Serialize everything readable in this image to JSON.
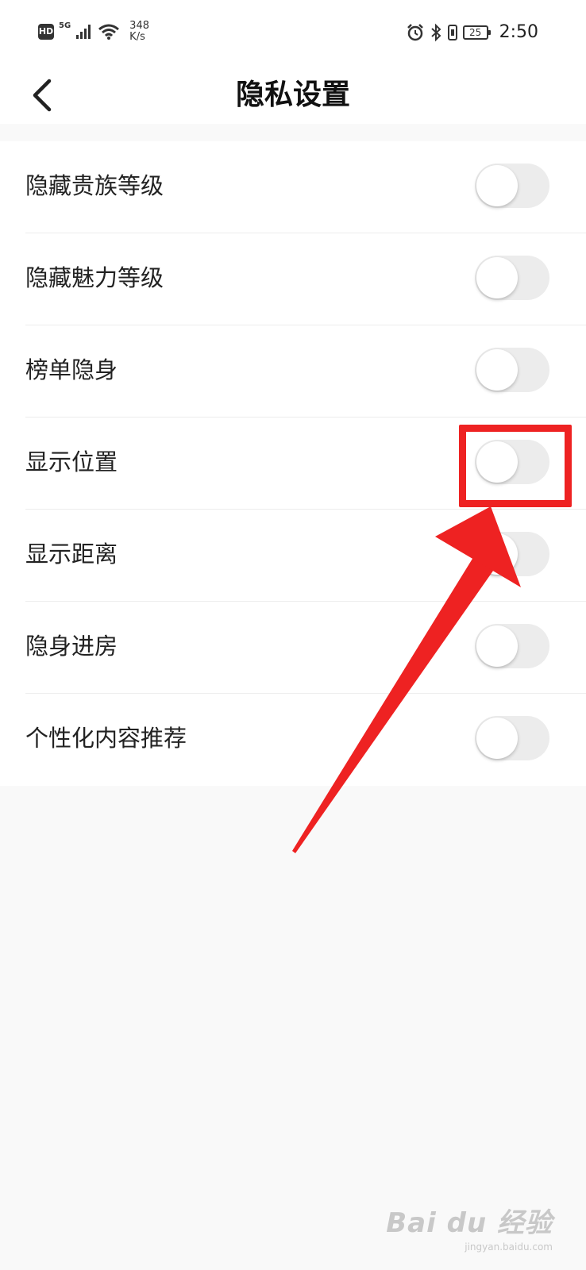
{
  "status_bar": {
    "hd": "HD",
    "network": "5G",
    "speed_value": "348",
    "speed_unit": "K/s",
    "battery": "25",
    "time": "2:50"
  },
  "header": {
    "title": "隐私设置"
  },
  "settings": [
    {
      "label": "隐藏贵族等级",
      "enabled": false
    },
    {
      "label": "隐藏魅力等级",
      "enabled": false
    },
    {
      "label": "榜单隐身",
      "enabled": false
    },
    {
      "label": "显示位置",
      "enabled": false
    },
    {
      "label": "显示距离",
      "enabled": false
    },
    {
      "label": "隐身进房",
      "enabled": false
    },
    {
      "label": "个性化内容推荐",
      "enabled": false
    }
  ],
  "annotation": {
    "color": "#ee2222"
  },
  "watermark": {
    "brand": "Bai du 经验",
    "url": "jingyan.baidu.com"
  },
  "colors": {
    "toggle_off_track": "#ececec",
    "toggle_knob": "#ffffff",
    "page_background": "#f9f9f9"
  }
}
